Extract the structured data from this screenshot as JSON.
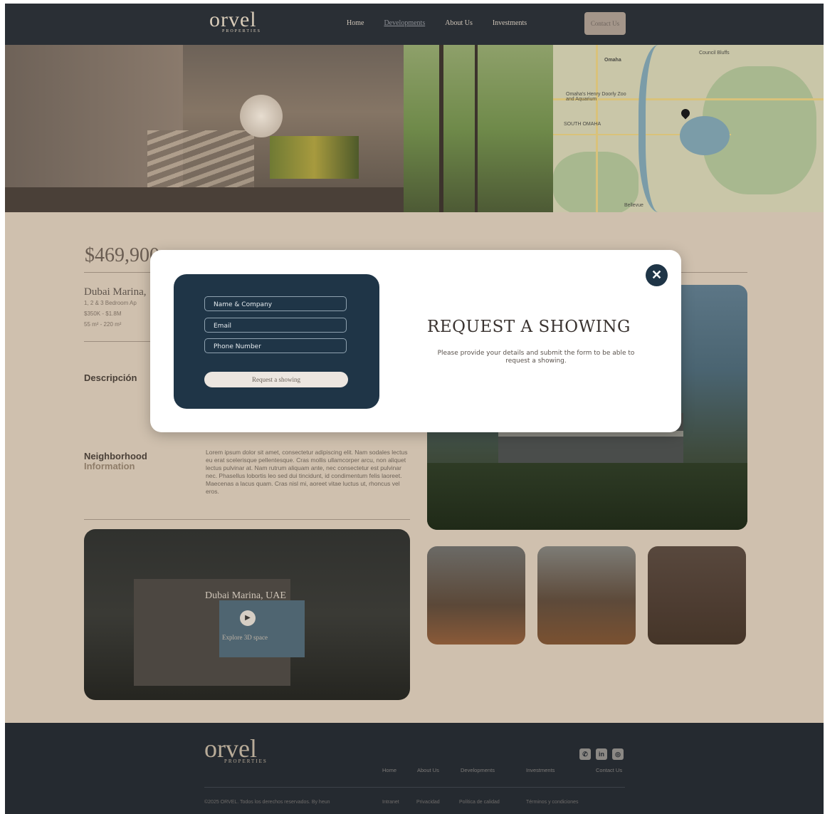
{
  "header": {
    "logo": "orvel",
    "logo_sub": "PROPERTIES",
    "nav": [
      "Home",
      "Developments",
      "About Us",
      "Investments"
    ],
    "contact": "Contact Us"
  },
  "map": {
    "labels": [
      "Omaha",
      "Council Bluffs",
      "Omaha's Henry Doorly Zoo and Aquarium",
      "SOUTH OMAHA",
      "Bellevue"
    ]
  },
  "listing": {
    "price": "$469,900",
    "title": "Dubai Marina,",
    "lines": [
      "1, 2 & 3 Bedroom Ap",
      "$350K - $1.8M",
      "55 m² - 220 m²"
    ],
    "description_heading": "Descripción",
    "neighborhood_heading": "Neighborhood",
    "neighborhood_sub": "Information",
    "neighborhood_text": "Lorem ipsum dolor sit amet, consectetur adipiscing elit. Nam sodales lectus eu erat scelerisque pellentesque. Cras mollis ullamcorper arcu, non aliquet lectus pulvinar at. Nam rutrum aliquam ante, nec consectetur est pulvinar nec. Phasellus lobortis leo sed dui tincidunt, id condimentum felis laoreet. Maecenas a lacus quam. Cras nisl mi, aoreet vitae luctus ut, rhoncus vel eros."
  },
  "video": {
    "title": "Dubai Marina, UAE",
    "subtitle": "Explore 3D space"
  },
  "modal": {
    "fields": [
      {
        "placeholder": "Name & Company"
      },
      {
        "placeholder": "Email"
      },
      {
        "placeholder": "Phone Number"
      }
    ],
    "submit": "Request a showing",
    "title": "REQUEST A SHOWING",
    "description": "Please provide your details and submit the form to be able to request a showing.",
    "close": "✕"
  },
  "footer": {
    "logo": "orvel",
    "logo_sub": "PROPERTIES",
    "links": [
      "Home",
      "About Us",
      "Developments",
      "Investments",
      "Contact Us"
    ],
    "copyright": "©2025 ORVEL. Todos los derechos reservados. By heun",
    "legal": [
      "Intranet",
      "Privacidad",
      "Política de calidad",
      "Términos y condiciones"
    ],
    "social": [
      "whatsapp-icon",
      "linkedin-icon",
      "instagram-icon"
    ]
  },
  "colors": {
    "overlay_bg": "#cfc0ae",
    "modal_panel": "#1f3547",
    "header": "#2a2f35"
  }
}
